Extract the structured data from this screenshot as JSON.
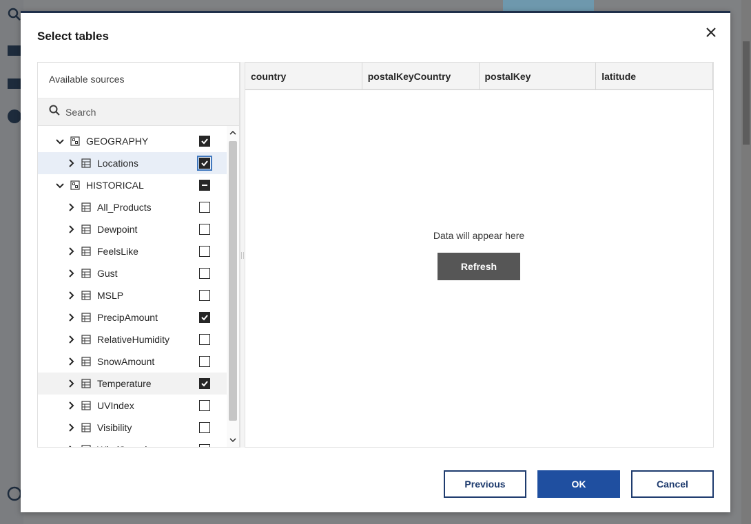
{
  "dialog": {
    "title": "Select tables",
    "close_icon": "close-icon"
  },
  "sources": {
    "header": "Available sources",
    "search_placeholder": "Search",
    "tree": [
      {
        "label": "GEOGRAPHY",
        "level": "schema",
        "state": "checked",
        "expanded": true
      },
      {
        "label": "Locations",
        "level": "table",
        "state": "checked",
        "selected": true
      },
      {
        "label": "HISTORICAL",
        "level": "schema",
        "state": "mixed",
        "expanded": true
      },
      {
        "label": "All_Products",
        "level": "table",
        "state": "unchecked"
      },
      {
        "label": "Dewpoint",
        "level": "table",
        "state": "unchecked"
      },
      {
        "label": "FeelsLike",
        "level": "table",
        "state": "unchecked"
      },
      {
        "label": "Gust",
        "level": "table",
        "state": "unchecked"
      },
      {
        "label": "MSLP",
        "level": "table",
        "state": "unchecked"
      },
      {
        "label": "PrecipAmount",
        "level": "table",
        "state": "checked"
      },
      {
        "label": "RelativeHumidity",
        "level": "table",
        "state": "unchecked"
      },
      {
        "label": "SnowAmount",
        "level": "table",
        "state": "unchecked"
      },
      {
        "label": "Temperature",
        "level": "table",
        "state": "checked",
        "hovered": true
      },
      {
        "label": "UVIndex",
        "level": "table",
        "state": "unchecked"
      },
      {
        "label": "Visibility",
        "level": "table",
        "state": "unchecked"
      },
      {
        "label": "WindSpeed",
        "level": "table",
        "state": "unchecked"
      }
    ]
  },
  "preview": {
    "columns": [
      "country",
      "postalKeyCountry",
      "postalKey",
      "latitude"
    ],
    "empty_message": "Data will appear here",
    "refresh_label": "Refresh"
  },
  "footer": {
    "previous_label": "Previous",
    "ok_label": "OK",
    "cancel_label": "Cancel"
  },
  "colors": {
    "primary": "#1f4fa0",
    "outline": "#1e3b6e",
    "refresh": "#565656",
    "selected_row": "#e8eef7"
  }
}
